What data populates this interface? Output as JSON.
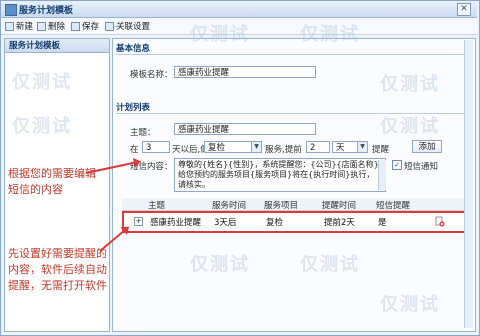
{
  "window": {
    "title": "服务计划模板",
    "close_label": "✕"
  },
  "toolbar": {
    "new_label": "新建",
    "delete_label": "删除",
    "save_label": "保存",
    "associate_label": "关联设置"
  },
  "left_panel": {
    "title": "服务计划模板"
  },
  "annotations": {
    "note1": [
      "根据您的需要编辑",
      "短信的内容"
    ],
    "note2": [
      "先设置好需要提醒的",
      "内容，软件后续自动",
      "提醒，无需打开软件"
    ]
  },
  "basic_info": {
    "section_title": "基本信息",
    "template_name_label": "模板名称：",
    "template_name_value": "感康药业提醒"
  },
  "plan_list": {
    "section_title": "计划列表",
    "subject_label": "主题：",
    "subject_value": "感康药业提醒",
    "when_prefix": "在",
    "days_value": "3",
    "days_after_text": "天以后,做",
    "service_value": "复检",
    "service_ahead_text": "服务,提前",
    "ahead_value": "2",
    "ahead_unit": "天",
    "remind_label": "提醒",
    "add_button": "添加",
    "sms_label": "短信内容：",
    "sms_text": "尊敬的{姓名}{性别}，系统提醒您：{公司}{店面名称}给您预约的服务项目{服务项目}将在{执行时间}执行，请核实。",
    "sms_notify_label": "短信通知",
    "sms_notify_checked": true
  },
  "grid": {
    "columns": [
      "主题",
      "服务时间",
      "服务项目",
      "提醒时间",
      "短信提醒"
    ],
    "rows": [
      {
        "subject": "感康药业提醒",
        "service_time": "3天后",
        "service_item": "复检",
        "remind_time": "提前2天",
        "sms": "是"
      }
    ]
  },
  "watermark": {
    "text": "仅测试"
  }
}
